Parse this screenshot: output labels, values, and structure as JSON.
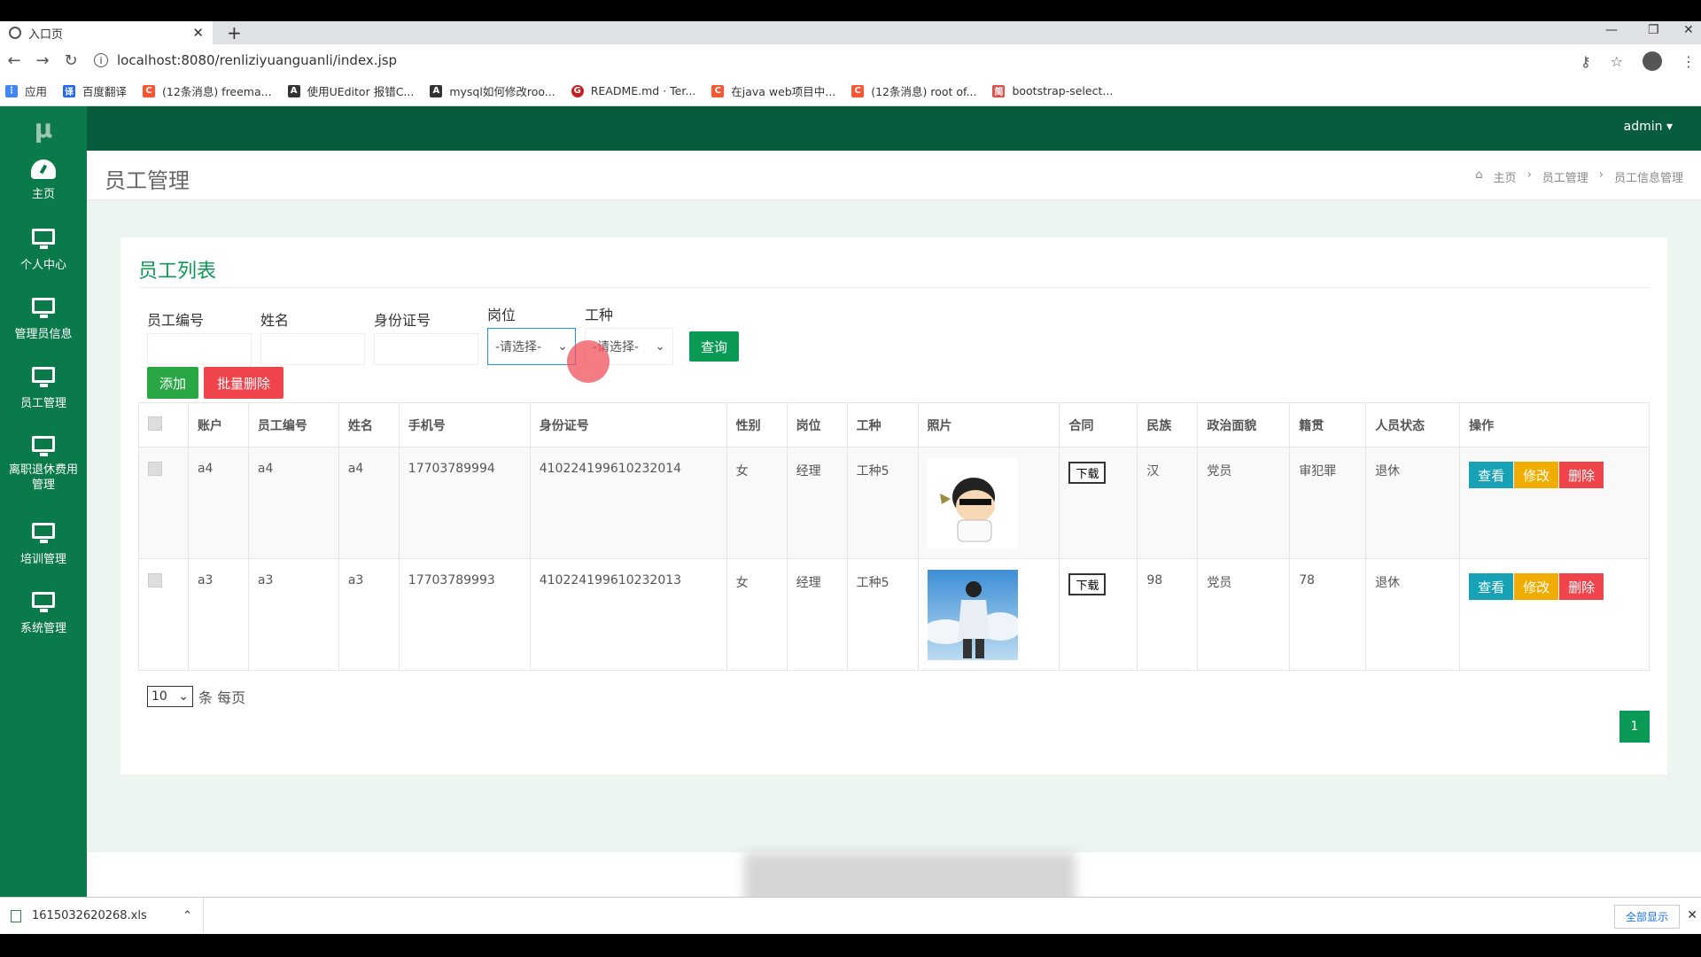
{
  "browser": {
    "tab_title": "入口页",
    "url": "localhost:8080/renliziyuanguanli/index.jsp",
    "bookmarks": [
      {
        "label": "应用",
        "icon": "apps-grid-icon",
        "color": "#4285f4"
      },
      {
        "label": "百度翻译",
        "icon": "baidu-translate-icon",
        "color": "#2468f2"
      },
      {
        "label": "(12条消息) freema...",
        "icon": "csdn-icon",
        "color": "#fc5531"
      },
      {
        "label": "使用UEditor 报错C...",
        "icon": "script-icon",
        "color": "#333333"
      },
      {
        "label": "mysql如何修改roo...",
        "icon": "script-icon",
        "color": "#333333"
      },
      {
        "label": "README.md · Ter...",
        "icon": "gitee-icon",
        "color": "#c71d23"
      },
      {
        "label": "在java web项目中...",
        "icon": "csdn-icon",
        "color": "#fc5531"
      },
      {
        "label": "(12条消息) root of...",
        "icon": "csdn-icon",
        "color": "#fc5531"
      },
      {
        "label": "bootstrap-select...",
        "icon": "bootstrap-icon",
        "color": "#d9534f"
      }
    ]
  },
  "sidebar": {
    "logo": "μ",
    "items": [
      {
        "label": "主页",
        "icon": "dashboard-icon"
      },
      {
        "label": "个人中心",
        "icon": "monitor-icon"
      },
      {
        "label": "管理员信息",
        "icon": "monitor-icon"
      },
      {
        "label": "员工管理",
        "icon": "monitor-icon"
      },
      {
        "label": "离职退休费用管理",
        "icon": "monitor-icon"
      },
      {
        "label": "培训管理",
        "icon": "monitor-icon"
      },
      {
        "label": "系统管理",
        "icon": "monitor-icon"
      }
    ]
  },
  "header": {
    "user": "admin ▾"
  },
  "page": {
    "title": "员工管理",
    "breadcrumb": [
      "主页",
      "员工管理",
      "员工信息管理"
    ]
  },
  "panel": {
    "title": "员工列表",
    "filters": {
      "emp_no_label": "员工编号",
      "name_label": "姓名",
      "id_label": "身份证号",
      "post_label": "岗位",
      "post_value": "-请选择-",
      "worktype_label": "工种",
      "worktype_value": "-请选择-",
      "query_button": "查询"
    },
    "add_button": "添加",
    "bulk_delete_button": "批量删除",
    "columns": [
      "",
      "账户",
      "员工编号",
      "姓名",
      "手机号",
      "身份证号",
      "性别",
      "岗位",
      "工种",
      "照片",
      "合同",
      "民族",
      "政治面貌",
      "籍贯",
      "人员状态",
      "操作"
    ],
    "rows": [
      {
        "account": "a4",
        "emp_no": "a4",
        "name": "a4",
        "phone": "17703789994",
        "id_no": "410224199610232014",
        "gender": "女",
        "post": "经理",
        "worktype": "工种5",
        "contract": "下载",
        "ethnicity": "汉",
        "political": "党员",
        "origin": "审犯罪",
        "status": "退休"
      },
      {
        "account": "a3",
        "emp_no": "a3",
        "name": "a3",
        "phone": "17703789993",
        "id_no": "410224199610232013",
        "gender": "女",
        "post": "经理",
        "worktype": "工种5",
        "contract": "下载",
        "ethnicity": "98",
        "political": "党员",
        "origin": "78",
        "status": "退休"
      }
    ],
    "row_actions": {
      "view": "查看",
      "edit": "修改",
      "delete": "删除"
    },
    "page_size": "10",
    "page_size_suffix": "条 每页",
    "current_page": "1"
  },
  "downloads": {
    "file": "1615032620268.xls",
    "show_all": "全部显示"
  },
  "colors": {
    "sidebar": "#0b7a4a",
    "header": "#075c3d",
    "accent": "#0b9a55",
    "view": "#17a2b8",
    "edit": "#f0ad00",
    "delete": "#f0444d"
  }
}
